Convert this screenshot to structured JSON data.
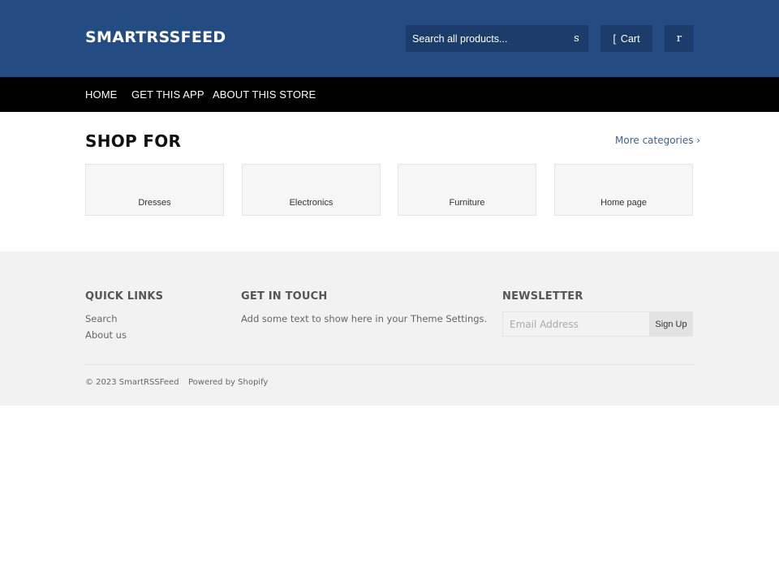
{
  "header": {
    "logo": "SMARTRSSFEED",
    "search_placeholder": "Search all products...",
    "search_button": "s",
    "cart_icon": "[",
    "cart_label": "Cart",
    "menu_button": "r",
    "background_color": "#234c83"
  },
  "nav": {
    "items": [
      {
        "label": "HOME"
      },
      {
        "label": "GET THIS APP"
      },
      {
        "label": "ABOUT THIS STORE"
      }
    ]
  },
  "main": {
    "title": "SHOP FOR",
    "more_link": "More categories ›",
    "categories": [
      {
        "label": "Dresses"
      },
      {
        "label": "Electronics"
      },
      {
        "label": "Furniture"
      },
      {
        "label": "Home page"
      }
    ]
  },
  "footer": {
    "quick_links": {
      "heading": "QUICK LINKS",
      "links": [
        {
          "label": "Search"
        },
        {
          "label": "About us"
        }
      ]
    },
    "get_in_touch": {
      "heading": "GET IN TOUCH",
      "text": "Add some text to show here in your Theme Settings."
    },
    "newsletter": {
      "heading": "NEWSLETTER",
      "email_placeholder": "Email Address",
      "signup_label": "Sign Up"
    },
    "copyright": "© 2023 SmartRSSFeed",
    "powered_by": "Powered by Shopify"
  }
}
